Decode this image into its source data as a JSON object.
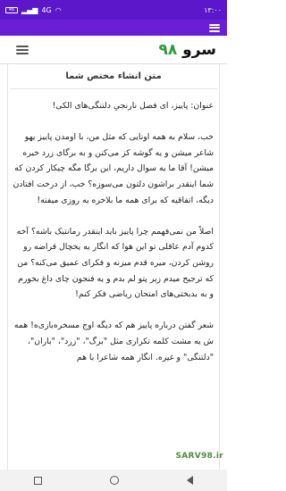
{
  "status_bar": {
    "time": "۱۳:۰۰",
    "network": "4G",
    "battery": "46",
    "bg_color": "#5b17c9"
  },
  "app_bar": {
    "bg_color": "#6a1fd6",
    "menu_icon": "hamburger-icon"
  },
  "site_header": {
    "logo_word": "سرو",
    "logo_number": "۹۸",
    "logo_number_color": "#2e9c3a",
    "menu_icon": "hamburger-icon"
  },
  "page": {
    "title": "متن انشاء مختص شما"
  },
  "article": {
    "paragraphs": [
      "عنوان: پاییز، ای فصل نارنجیِ دلتنگی‌های الکی!",
      "خب، سلام به همه اونایی که مثل من، با اومدن پاییز یهو شاعر میشن و یه گوشه کز می‌کنن و به برگای زرد خیره میشن! آقا ما یه سوال داریم، این برگا مگه چیکار کردن که شما اینقدر براشون دلتون می‌سوزه؟ خب، از درخت افتادن دیگه، اتفاقیه که برای همه ما بلاخره یه روزی میفته!",
      "اصلاً من نمی‌فهمم چرا پاییز باید اینقدر رمانتیک باشه؟ آخه کدوم آدم عاقلی تو این هوا که انگار یه یخچال قراضه رو روشن کردن، میره قدم میزنه و فکرای عمیق می‌کنه؟ من که ترجیح میدم زیر پتو لم بدم و یه فنجون چای داغ بخورم و به بدبختی‌های امتحان ریاضی فکر کنم!",
      "شعر گفتن درباره پاییز هم که دیگه اوج مسخره‌بازی‌ه! همه ش یه مشت کلمه تکراری مثل \"برگ\"، \"زرد\"، \"باران\"، \"دلتنگی\" و غیره. انگار همه شاعرا با هم"
    ]
  },
  "watermark": "SARV98.ir",
  "nav_bar": {
    "back_icon": "back-triangle-icon",
    "home_icon": "home-circle-icon",
    "recent_icon": "recent-apps-icon"
  }
}
